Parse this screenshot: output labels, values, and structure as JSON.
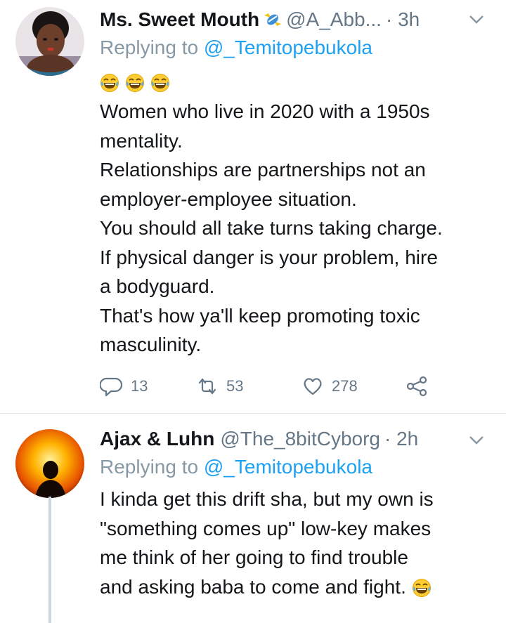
{
  "tweets": [
    {
      "name": "Ms. Sweet Mouth",
      "name_emoji": "candy-icon",
      "handle": "@A_Abb...",
      "time": "· 3h",
      "reply_prefix": "Replying to",
      "reply_to": "@_Temitopebukola",
      "leading_emojis": [
        "face-with-tears-of-joy-icon",
        "face-with-tears-of-joy-icon",
        "face-with-tears-of-joy-icon"
      ],
      "lines": [
        "Women who live in 2020 with a 1950s",
        "mentality.",
        "Relationships are partnerships not an",
        "employer-employee situation.",
        "You should all take turns taking charge.",
        "If physical danger is your problem, hire",
        "a bodyguard.",
        "That's how ya'll keep promoting toxic",
        "masculinity."
      ],
      "actions": {
        "replies": "13",
        "retweets": "53",
        "likes": "278"
      }
    },
    {
      "name": "Ajax & Luhn",
      "handle": "@The_8bitCyborg",
      "time": "· 2h",
      "reply_prefix": "Replying to",
      "reply_to": "@_Temitopebukola",
      "lines": [
        "I kinda get this drift sha, but my own is",
        "\"something comes up\" low-key makes",
        "me think of her going to find trouble",
        "and asking baba to come and fight."
      ],
      "trailing_emoji": "face-with-tears-of-joy-icon"
    }
  ],
  "colors": {
    "secondary": "#657786",
    "link": "#1da1f2",
    "thread_line": "#ccd6dd"
  }
}
